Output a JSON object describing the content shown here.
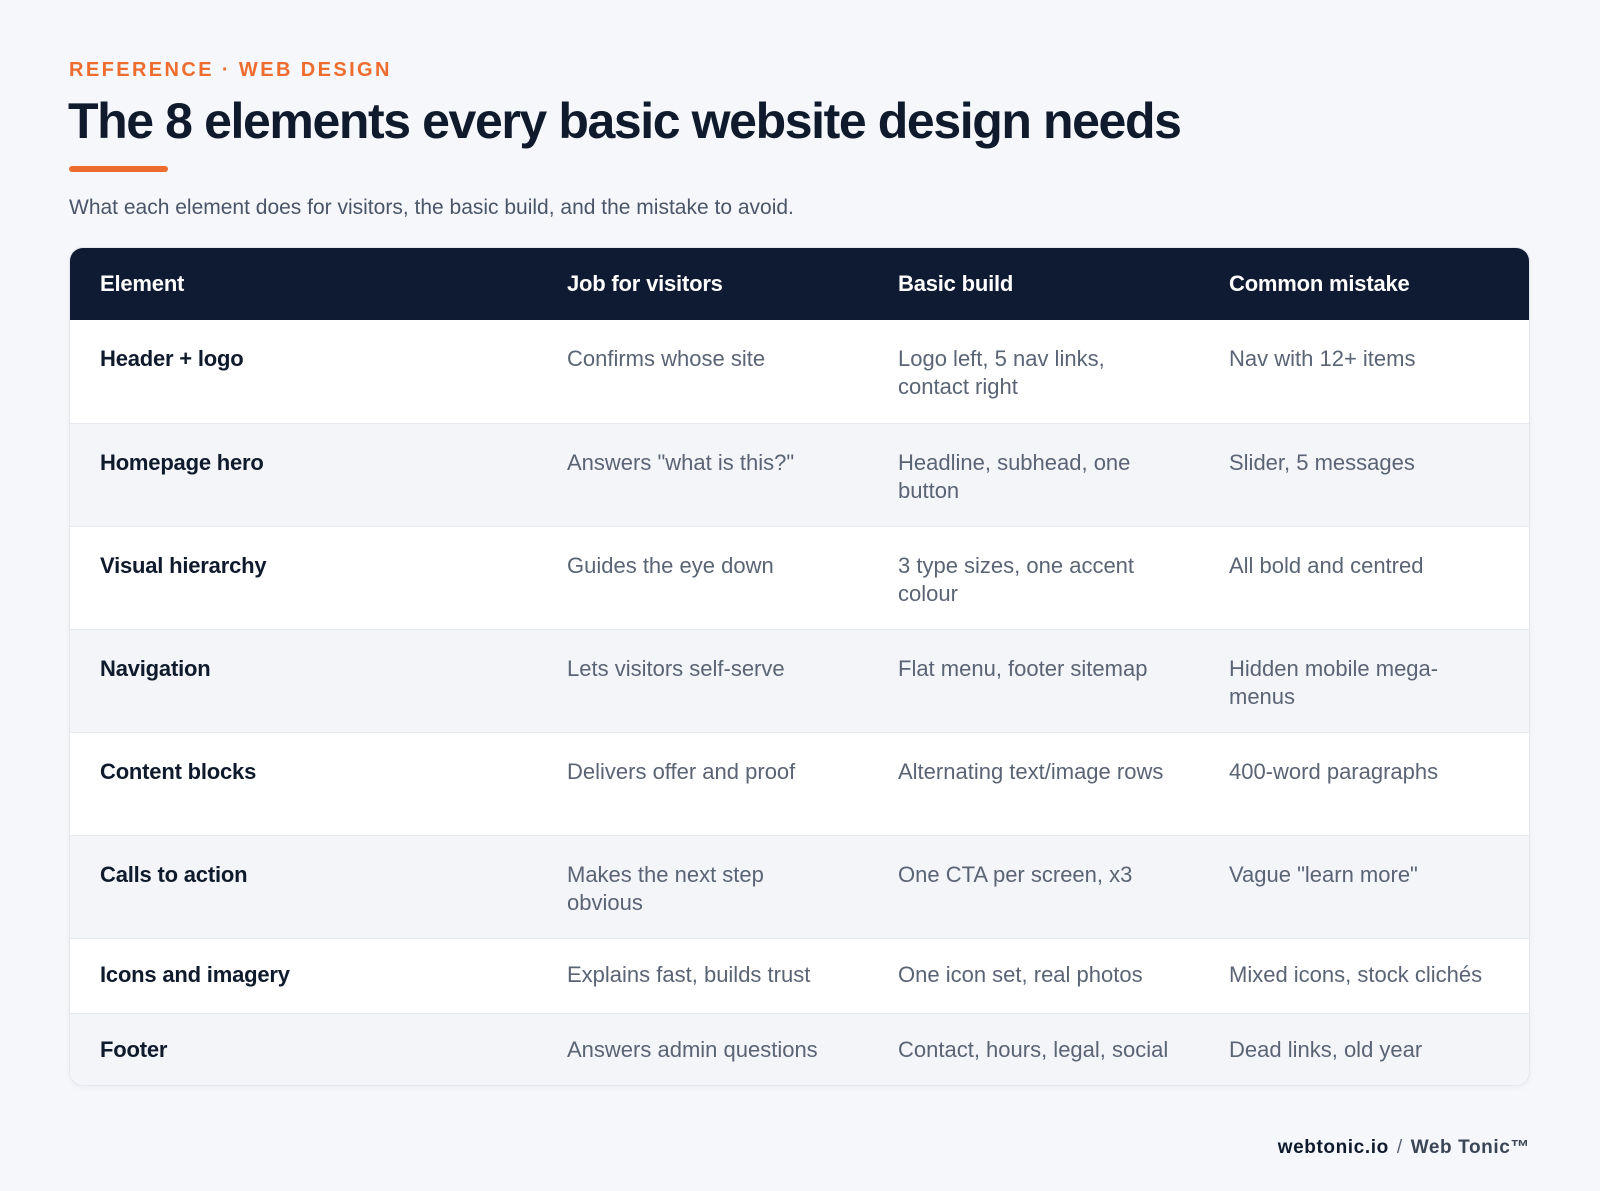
{
  "header": {
    "eyebrow": "REFERENCE · WEB DESIGN",
    "title": "The 8 elements every basic website design needs",
    "subtitle": "What each element does for visitors, the basic build, and the mistake to avoid."
  },
  "table": {
    "columns": [
      "Element",
      "Job for visitors",
      "Basic build",
      "Common mistake"
    ],
    "rows": [
      {
        "element": "Header + logo",
        "job": "Confirms whose site",
        "build": "Logo left, 5 nav links, contact right",
        "mistake": "Nav with 12+ items"
      },
      {
        "element": "Homepage hero",
        "job": "Answers \"what is this?\"",
        "build": "Headline, subhead, one button",
        "mistake": "Slider, 5 messages"
      },
      {
        "element": "Visual hierarchy",
        "job": "Guides the eye down",
        "build": "3 type sizes, one accent colour",
        "mistake": "All bold and centred"
      },
      {
        "element": "Navigation",
        "job": "Lets visitors self-serve",
        "build": "Flat menu, footer sitemap",
        "mistake": "Hidden mobile mega-menus"
      },
      {
        "element": "Content blocks",
        "job": "Delivers offer and proof",
        "build": "Alternating text/image rows",
        "mistake": "400-word paragraphs"
      },
      {
        "element": "Calls to action",
        "job": "Makes the next step obvious",
        "build": "One CTA per screen, x3",
        "mistake": "Vague \"learn more\""
      },
      {
        "element": "Icons and imagery",
        "job": "Explains fast, builds trust",
        "build": "One icon set, real photos",
        "mistake": "Mixed icons, stock clichés"
      },
      {
        "element": "Footer",
        "job": "Answers admin questions",
        "build": "Contact, hours, legal, social",
        "mistake": "Dead links, old year"
      }
    ]
  },
  "footer": {
    "domain": "webtonic.io",
    "separator": "/",
    "brand": "Web Tonic™"
  },
  "colors": {
    "accent": "#ef6c2f",
    "header_bg": "#0f1b33",
    "text_dark": "#0f1b2d",
    "text_muted": "#5a6474",
    "alt_row": "#f3f5f8",
    "page_bg": "#f5f7fa"
  }
}
